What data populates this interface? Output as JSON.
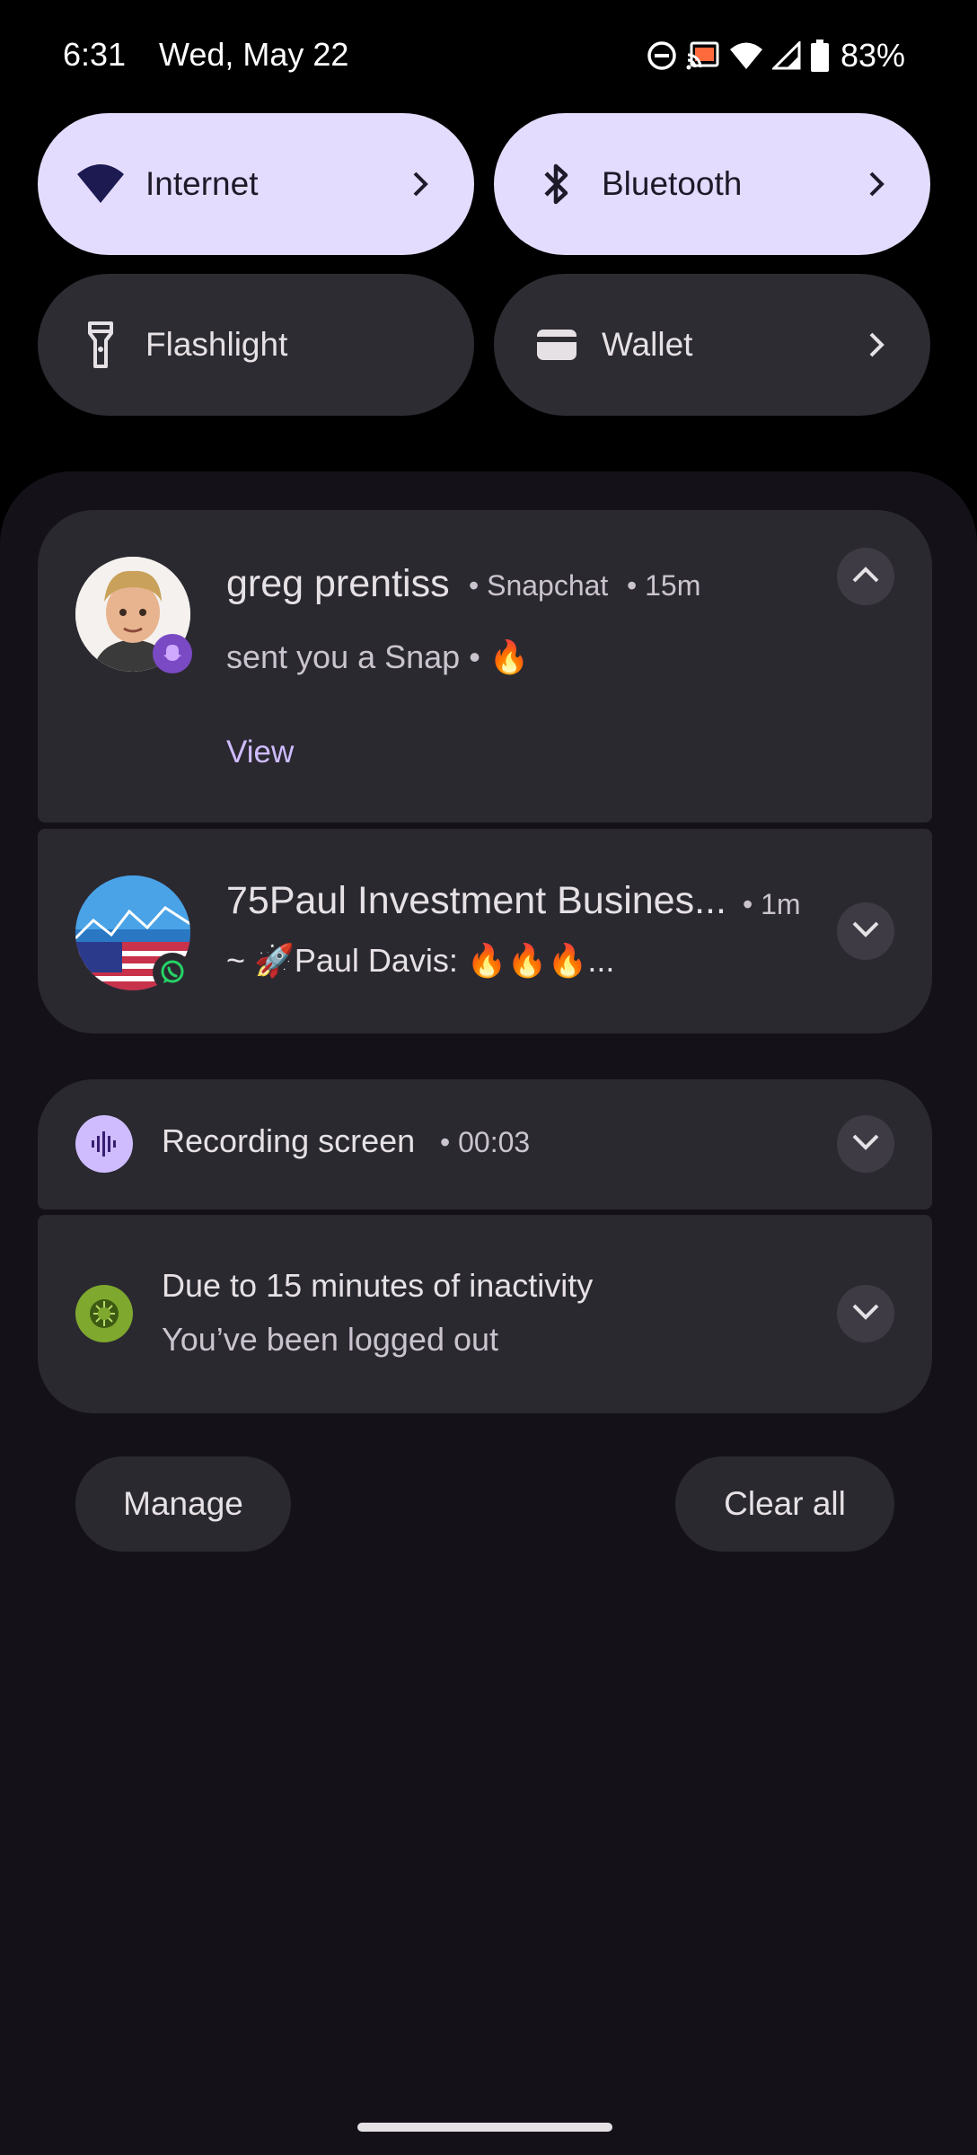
{
  "status_bar": {
    "time": "6:31",
    "date": "Wed, May 22",
    "battery": "83%",
    "icons": [
      "do-not-disturb-icon",
      "cast-icon",
      "wifi-icon",
      "cell-signal-icon",
      "battery-icon"
    ]
  },
  "quick_settings": {
    "tiles": [
      {
        "label": "Internet",
        "icon": "wifi-icon",
        "active": true,
        "has_chevron": true
      },
      {
        "label": "Bluetooth",
        "icon": "bluetooth-icon",
        "active": true,
        "has_chevron": true
      },
      {
        "label": "Flashlight",
        "icon": "flashlight-icon",
        "active": false,
        "has_chevron": false
      },
      {
        "label": "Wallet",
        "icon": "wallet-icon",
        "active": false,
        "has_chevron": true
      }
    ]
  },
  "notifications": [
    {
      "title": "greg prentiss",
      "app": "• Snapchat",
      "time": "• 15m",
      "body": "sent you a Snap • 🔥",
      "action": "View",
      "badge_icon": "snapchat-icon",
      "expanded": true
    },
    {
      "title": "75Paul Investment Busines...",
      "time": "• 1m",
      "body": "~ 🚀Paul Davis: 🔥🔥🔥...",
      "badge_icon": "whatsapp-icon",
      "expanded": false
    },
    {
      "title": "Recording screen",
      "time": "• 00:03",
      "icon": "sound-wave-icon",
      "expanded": false
    },
    {
      "title": "Due to 15 minutes of inactivity",
      "body": "You’ve been logged out",
      "icon": "app-logo-icon",
      "expanded": false
    }
  ],
  "footer": {
    "manage_label": "Manage",
    "clear_all_label": "Clear all"
  },
  "colors": {
    "tile_active_bg": "#e4dcff",
    "tile_inactive_bg": "#2d2c32",
    "shade_bg": "#141218",
    "card_bg": "#2b2930",
    "accent": "#cfbcff"
  }
}
